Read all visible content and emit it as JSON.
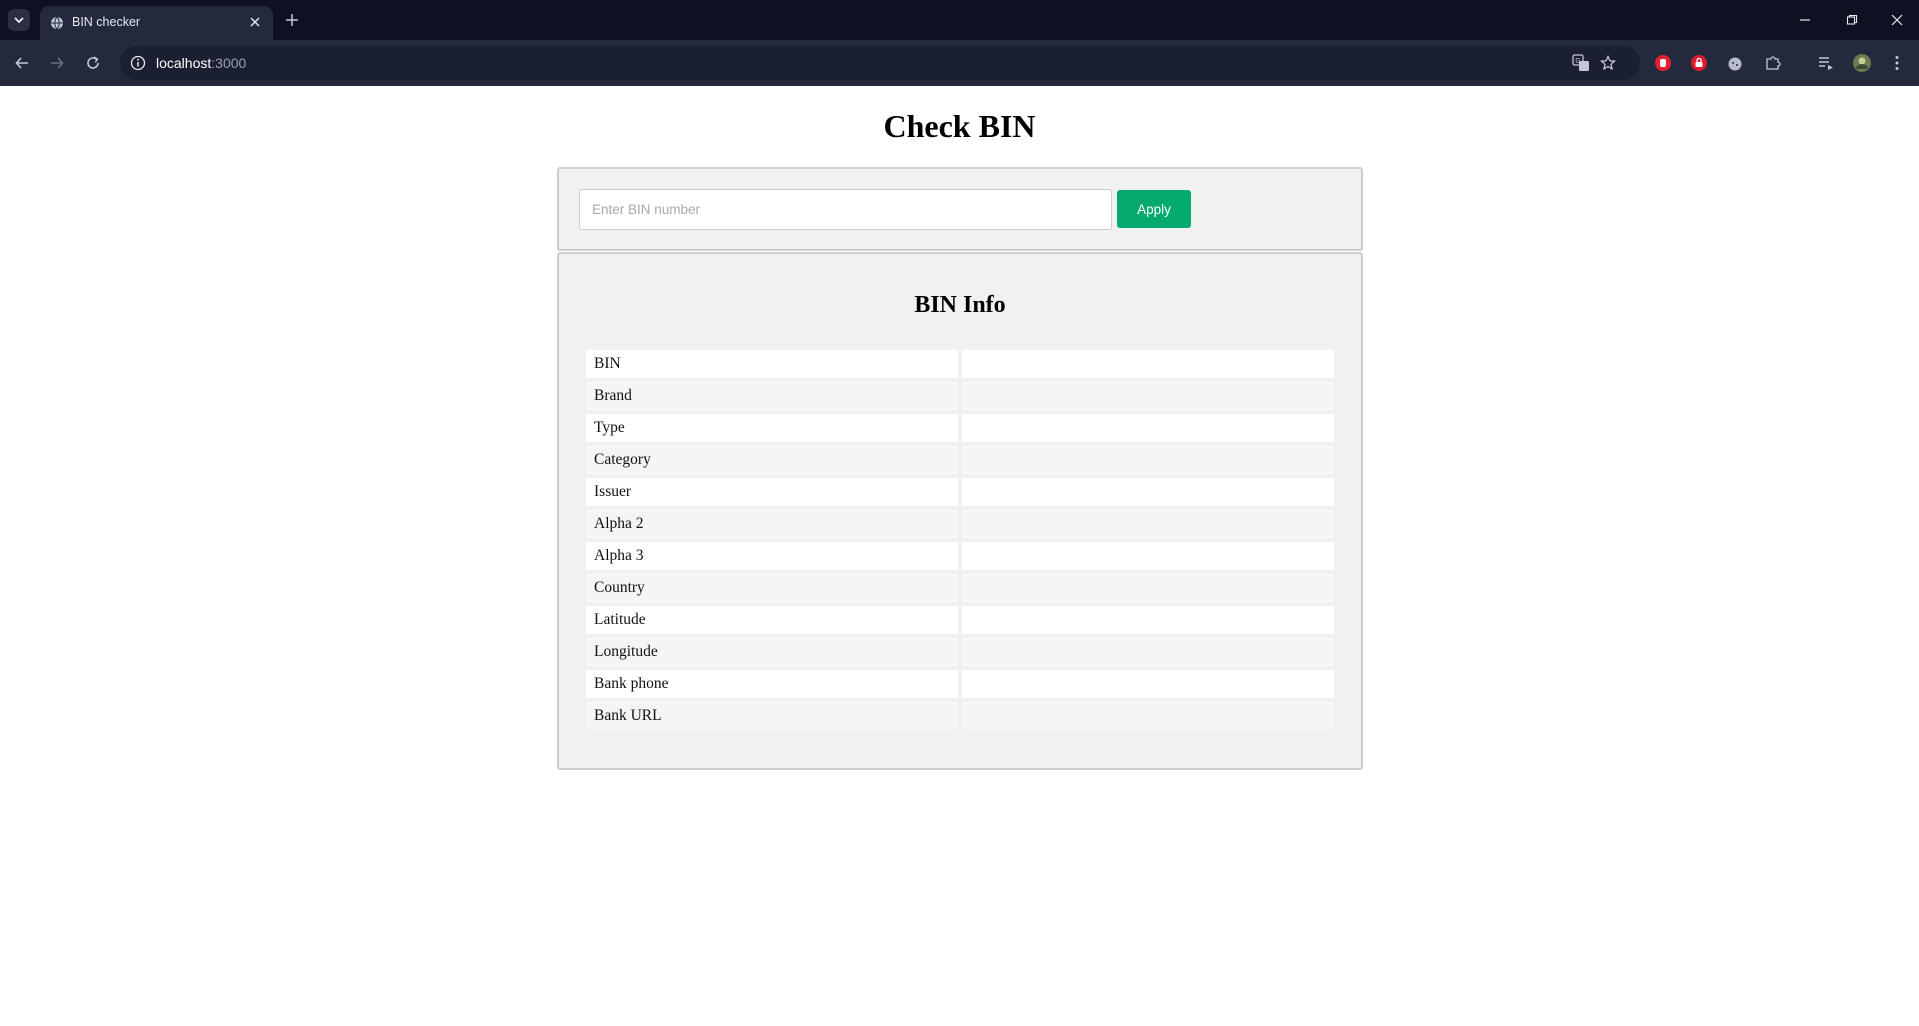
{
  "browser": {
    "tab_title": "BIN checker",
    "url_host": "localhost",
    "url_port": ":3000"
  },
  "page": {
    "title": "Check BIN",
    "search": {
      "placeholder": "Enter BIN number",
      "value": "",
      "button_label": "Apply"
    },
    "info": {
      "title": "BIN Info",
      "rows": [
        {
          "label": "BIN",
          "value": ""
        },
        {
          "label": "Brand",
          "value": ""
        },
        {
          "label": "Type",
          "value": ""
        },
        {
          "label": "Category",
          "value": ""
        },
        {
          "label": "Issuer",
          "value": ""
        },
        {
          "label": "Alpha 2",
          "value": ""
        },
        {
          "label": "Alpha 3",
          "value": ""
        },
        {
          "label": "Country",
          "value": ""
        },
        {
          "label": "Latitude",
          "value": ""
        },
        {
          "label": "Longitude",
          "value": ""
        },
        {
          "label": "Bank phone",
          "value": ""
        },
        {
          "label": "Bank URL",
          "value": ""
        }
      ]
    }
  },
  "colors": {
    "accent": "#04aa6d",
    "chrome_dark": "#0e1122",
    "chrome_toolbar": "#232a3d",
    "panel_bg": "#f1f1f1"
  }
}
